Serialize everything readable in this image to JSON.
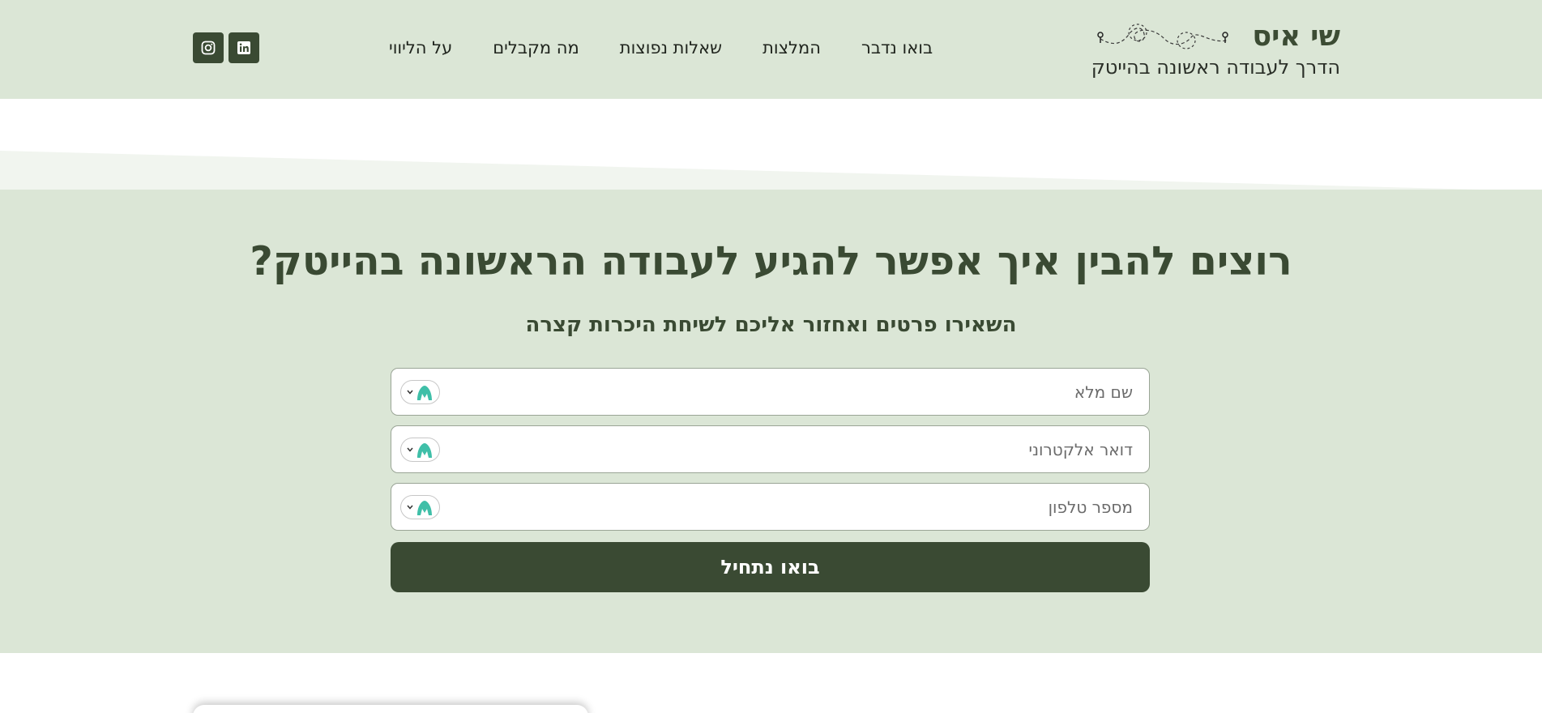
{
  "brand": {
    "name": "שי איס",
    "tagline": "הדרך לעבודה ראשונה בהייטק"
  },
  "nav": {
    "items": [
      {
        "label": "על הליווי"
      },
      {
        "label": "מה מקבלים"
      },
      {
        "label": "שאלות נפוצות"
      },
      {
        "label": "המלצות"
      },
      {
        "label": "בואו נדבר"
      }
    ]
  },
  "social": {
    "icons": [
      "linkedin-icon",
      "instagram-icon"
    ]
  },
  "hero": {
    "title": "רוצים להבין איך אפשר להגיע לעבודה הראשונה בהייטק?",
    "subtitle": "השאירו פרטים ואחזור אליכם לשיחת היכרות קצרה"
  },
  "form": {
    "name_placeholder": "שם מלא",
    "email_placeholder": "דואר אלקטרוני",
    "phone_placeholder": "מספר טלפון",
    "submit_label": "בואו נתחיל"
  },
  "colors": {
    "header_bg": "#dbe6d6",
    "dark_green": "#3a4a33",
    "autofill_accent": "#3fbfa8"
  }
}
